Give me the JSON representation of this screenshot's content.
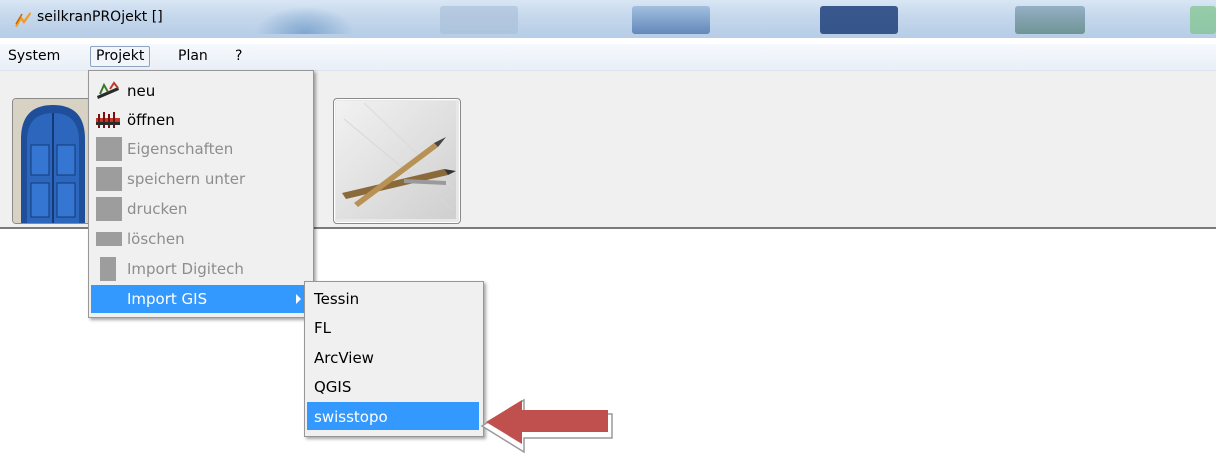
{
  "window": {
    "title": "seilkranPROjekt []"
  },
  "menubar": {
    "items": [
      {
        "label": "System"
      },
      {
        "label": "Projekt"
      },
      {
        "label": "Plan"
      },
      {
        "label": "?"
      }
    ]
  },
  "projekt_menu": {
    "items": [
      {
        "label": "neu",
        "enabled": true
      },
      {
        "label": "öffnen",
        "enabled": true
      },
      {
        "label": "Eigenschaften",
        "enabled": false
      },
      {
        "label": "speichern unter",
        "enabled": false
      },
      {
        "label": "drucken",
        "enabled": false
      },
      {
        "label": "löschen",
        "enabled": false
      },
      {
        "label": "Import Digitech",
        "enabled": false
      },
      {
        "label": "Import GIS",
        "enabled": true,
        "highlighted": true
      }
    ]
  },
  "import_gis_submenu": {
    "items": [
      {
        "label": "Tessin"
      },
      {
        "label": "FL"
      },
      {
        "label": "ArcView"
      },
      {
        "label": "QGIS"
      },
      {
        "label": "swisstopo",
        "highlighted": true
      }
    ]
  },
  "colors": {
    "highlight": "#3399ff",
    "annotation_arrow": "#c0504d"
  }
}
